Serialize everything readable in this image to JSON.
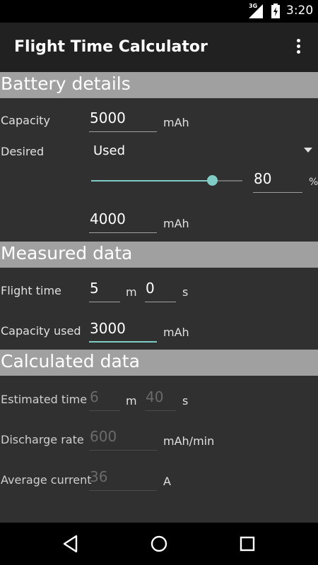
{
  "status": {
    "network": "3G",
    "time": "3:20"
  },
  "toolbar": {
    "title": "Flight Time Calculator",
    "menu_icon": "overflow-menu-icon"
  },
  "battery": {
    "header": "Battery details",
    "capacity_label": "Capacity",
    "capacity_value": "5000",
    "capacity_unit": "mAh",
    "desired_label": "Desired",
    "desired_value": "Used",
    "slider_percent": 80,
    "percent_value": "80",
    "percent_unit": "%",
    "desired_capacity_value": "4000",
    "desired_capacity_unit": "mAh"
  },
  "measured": {
    "header": "Measured data",
    "flight_time_label": "Flight time",
    "minutes_value": "5",
    "minutes_unit": "m",
    "seconds_value": "0",
    "seconds_unit": "s",
    "capacity_used_label": "Capacity used",
    "capacity_used_value": "3000",
    "capacity_used_unit": "mAh"
  },
  "calculated": {
    "header": "Calculated data",
    "estimated_time_label": "Estimated time",
    "est_minutes_value": "6",
    "est_minutes_unit": "m",
    "est_seconds_value": "40",
    "est_seconds_unit": "s",
    "discharge_rate_label": "Discharge rate",
    "discharge_rate_value": "600",
    "discharge_rate_unit": "mAh/min",
    "average_current_label": "Average current",
    "average_current_value": "36",
    "average_current_unit": "A"
  },
  "colors": {
    "accent": "#80cbc4",
    "toolbar": "#212121",
    "background": "#303030",
    "section": "#a0a0a0"
  },
  "navbar": {
    "back_icon": "back-icon",
    "home_icon": "home-icon",
    "recents_icon": "recents-icon"
  }
}
